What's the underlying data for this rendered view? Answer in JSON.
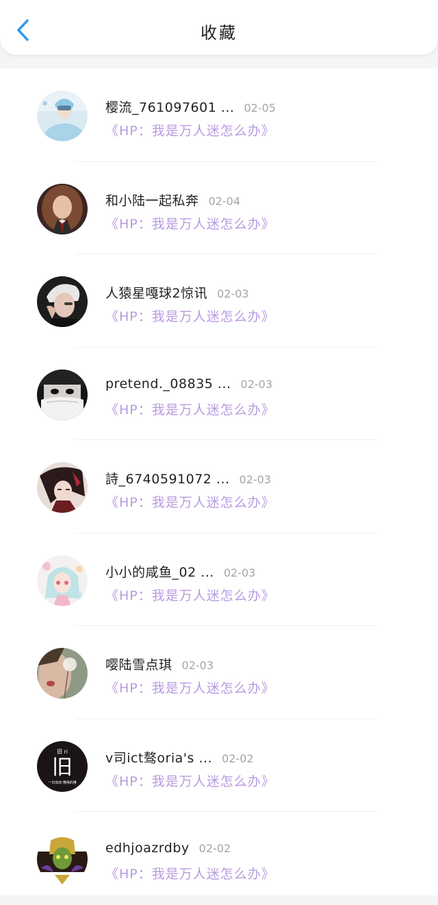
{
  "header": {
    "title": "收藏"
  },
  "items": [
    {
      "name": "樱流_761097601 ...",
      "date": "02-05",
      "book": "《HP：我是万人迷怎么办》",
      "avatar": "avatar-girl-light-blue"
    },
    {
      "name": "和小陆一起私奔",
      "date": "02-04",
      "book": "《HP：我是万人迷怎么办》",
      "avatar": "avatar-hermione-brown-hair"
    },
    {
      "name": "人猿星嘎球2惊讯",
      "date": "02-03",
      "book": "《HP：我是万人迷怎么办》",
      "avatar": "avatar-white-hair-boy"
    },
    {
      "name": "pretend._08835 ...",
      "date": "02-03",
      "book": "《HP：我是万人迷怎么办》",
      "avatar": "avatar-mask-girl"
    },
    {
      "name": "詩_6740591072 ...",
      "date": "02-03",
      "book": "《HP：我是万人迷怎么办》",
      "avatar": "avatar-anime-dark-hair"
    },
    {
      "name": "小小的咸鱼_02 ...",
      "date": "02-03",
      "book": "《HP：我是万人迷怎么办》",
      "avatar": "avatar-anime-pastel"
    },
    {
      "name": "嘤陆雪点琪",
      "date": "02-03",
      "book": "《HP：我是万人迷怎么办》",
      "avatar": "avatar-dandelion"
    },
    {
      "name": "v司ict骜oria's ...",
      "date": "02-02",
      "book": "《HP：我是万人迷怎么办》",
      "avatar": "avatar-black-logo"
    },
    {
      "name": "edhjoazrdby",
      "date": "02-02",
      "book": "《HP：我是万人迷怎么办》",
      "avatar": "avatar-game-character"
    }
  ],
  "avatar_logo": {
    "top": "旧 ri",
    "main": "旧",
    "bottom": "一日旧旧   懂得的懂"
  },
  "colors": {
    "accent": "#2f9af0",
    "book_title": "#b89ae0",
    "date": "#a5a5a5"
  }
}
